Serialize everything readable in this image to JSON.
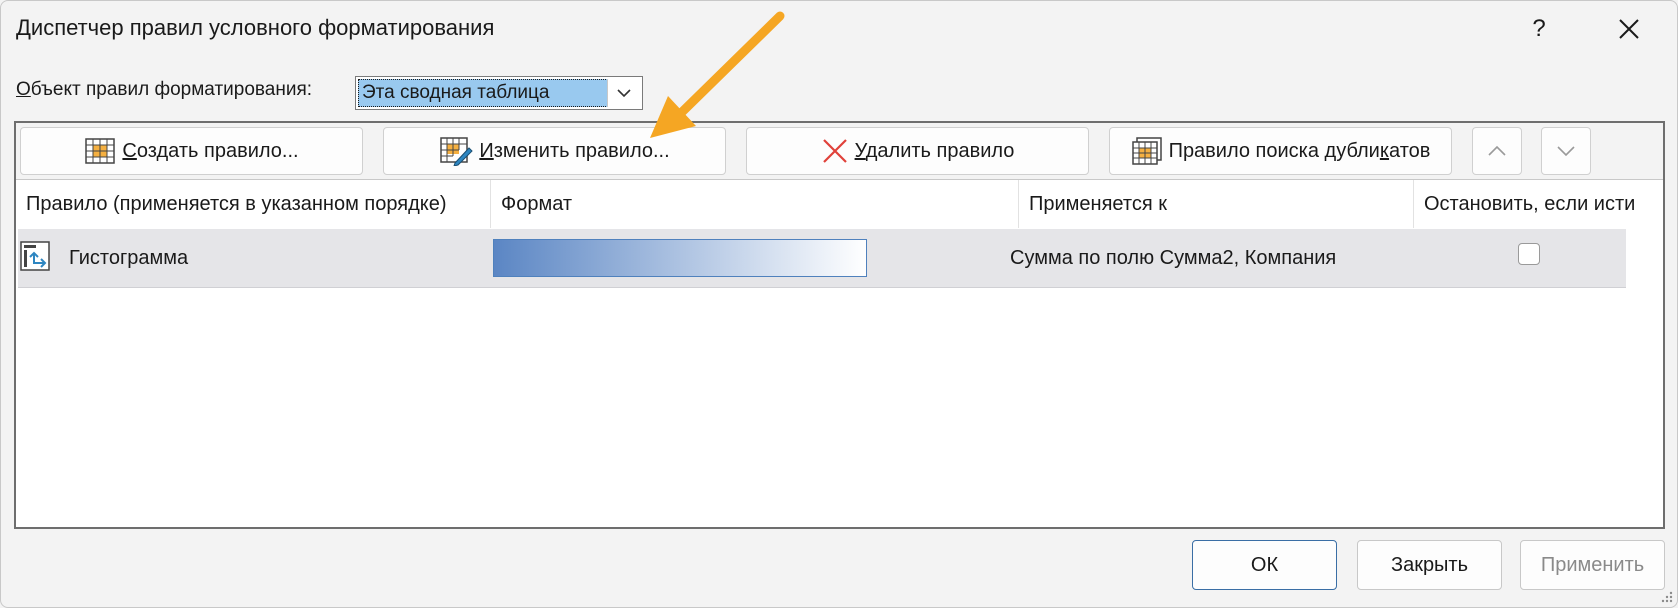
{
  "dialog": {
    "title": "Диспетчер правил условного форматирования",
    "help_label": "?",
    "close_label": "✕"
  },
  "scope": {
    "label_first": "О",
    "label_rest": "бъект правил форматирования:",
    "value": "Эта сводная таблица"
  },
  "toolbar": {
    "new_rule_underlined": "С",
    "new_rule_rest": "оздать правило...",
    "edit_rule_underlined": "И",
    "edit_rule_rest": "зменить правило...",
    "delete_rule_underlined": "У",
    "delete_rule_rest": "далить правило",
    "duplicate_rule_before": "Правило поиска дубли",
    "duplicate_rule_underlined": "к",
    "duplicate_rule_after": "атов"
  },
  "columns": [
    "Правило (применяется в указанном порядке)",
    "Формат",
    "Применяется к",
    "Остановить, если истина"
  ],
  "rules": [
    {
      "name": "Гистограмма",
      "applies_to": "Сумма по полю Сумма2, Компания",
      "stop_if_true": false
    }
  ],
  "buttons": {
    "ok": "ОК",
    "close": "Закрыть",
    "apply": "Применить"
  },
  "colors": {
    "annotation_arrow": "#f5a623",
    "databar_start": "#5b86c4",
    "databar_end": "#ffffff",
    "selection": "#99c9ef"
  },
  "icons": {
    "new_rule": "table-grid-icon",
    "edit_rule": "table-edit-icon",
    "delete_rule": "delete-x-icon",
    "duplicate_rule": "duplicate-table-icon",
    "move_up": "chevron-up-icon",
    "move_down": "chevron-down-icon",
    "rule_type": "databar-rule-icon",
    "annotation": "arrow-pointer"
  }
}
